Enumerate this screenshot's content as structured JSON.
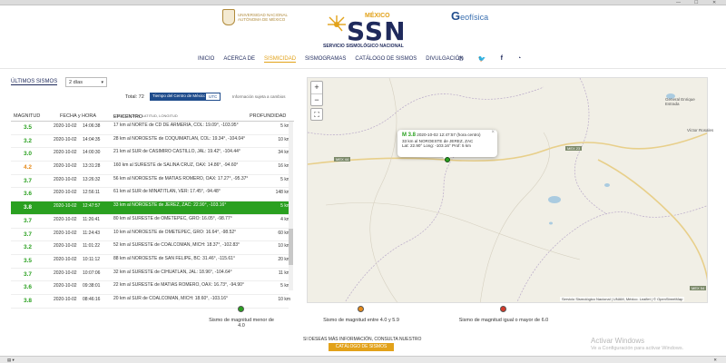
{
  "colors": {
    "navy": "#1f2a5c",
    "gold": "#e2a21a",
    "green": "#2aa020",
    "orange": "#e58a1a",
    "red": "#d43a2a"
  },
  "header": {
    "unam_text": "UNIVERSIDAD NACIONAL AUTÓNOMA DE MÉXICO",
    "ssn_mexico": "MÉXICO",
    "ssn_logo": "SSN",
    "ssn_subtitle": "SERVICIO SISMOLÓGICO NACIONAL",
    "geofisica": "eofísica"
  },
  "nav": {
    "items": [
      "INICIO",
      "ACERCA DE",
      "SISMICIDAD",
      "SISMOGRAMAS",
      "CATÁLOGO DE SISMOS",
      "DIVULGACIÓN"
    ],
    "icons": [
      "phone-icon",
      "twitter-icon",
      "facebook-icon",
      "rss-icon"
    ]
  },
  "panel": {
    "title": "ÚLTIMOS SISMOS",
    "days_selected": "2 días",
    "total_label": "Total: 72",
    "toggle_cm": "Tiempo del Centro de México",
    "toggle_utc": "UTC",
    "info_note": "Información sujeta a cambios"
  },
  "table": {
    "headers": {
      "magnitud": "MAGNITUD",
      "fecha": "FECHA y HORA",
      "epicentro": "EPICENTRO",
      "epicentro_sub": "LOCALIZACIÓN, LATITUD, LONGITUD",
      "profundidad": "PROFUNDIDAD"
    },
    "rows": [
      {
        "mag": "3.5",
        "color": "#2aa020",
        "date": "2020-10-02",
        "time": "14:06:38",
        "epi": "17 km al NORTE de CD DE ARMERIA, COL: 19.09°, -103.95°",
        "depth": "5 km"
      },
      {
        "mag": "3.2",
        "color": "#2aa020",
        "date": "2020-10-02",
        "time": "14:04:35",
        "epi": "28 km al NOROESTE de COQUIMATLAN, COL: 19.34°, -104.04°",
        "depth": "10 km"
      },
      {
        "mag": "3.0",
        "color": "#2aa020",
        "date": "2020-10-02",
        "time": "14:00:30",
        "epi": "21 km al SUR de CASIMIRO CASTILLO, JAL: 19.42°, -104.44°",
        "depth": "34 km"
      },
      {
        "mag": "4.2",
        "color": "#e58a1a",
        "date": "2020-10-02",
        "time": "13:31:28",
        "epi": "160 km al SURESTE de SALINA CRUZ, OAX: 14.86°, -94.60°",
        "depth": "16 km"
      },
      {
        "mag": "3.7",
        "color": "#2aa020",
        "date": "2020-10-02",
        "time": "13:26:32",
        "epi": "56 km al NOROESTE de MATIAS ROMERO, OAX: 17.27°, -95.37°",
        "depth": "5 km"
      },
      {
        "mag": "3.6",
        "color": "#2aa020",
        "date": "2020-10-02",
        "time": "12:56:11",
        "epi": "61 km al SUR de MINATITLAN, VER: 17.45°, -94.48°",
        "depth": "148 km"
      },
      {
        "mag": "3.8",
        "color": "#ffffff",
        "date": "2020-10-02",
        "time": "12:47:57",
        "epi": "33 km al NOROESTE de JEREZ, ZAC: 22.90°, -103.16°",
        "depth": "5 km",
        "selected": true
      },
      {
        "mag": "3.7",
        "color": "#2aa020",
        "date": "2020-10-02",
        "time": "11:26:41",
        "epi": "80 km al SURESTE de OMETEPEC, GRO: 16.05°, -98.77°",
        "depth": "4 km"
      },
      {
        "mag": "3.7",
        "color": "#2aa020",
        "date": "2020-10-02",
        "time": "11:24:43",
        "epi": "10 km al NOROESTE de OMETEPEC, GRO: 16.64°, -98.52°",
        "depth": "60 km"
      },
      {
        "mag": "3.2",
        "color": "#2aa020",
        "date": "2020-10-02",
        "time": "11:01:22",
        "epi": "52 km al SURESTE de COALCOMAN, MICH: 18.37°, -102.83°",
        "depth": "10 km"
      },
      {
        "mag": "3.5",
        "color": "#2aa020",
        "date": "2020-10-02",
        "time": "10:11:12",
        "epi": "88 km al NOROESTE de SAN FELIPE, BC: 31.46°, -115.61°",
        "depth": "20 km"
      },
      {
        "mag": "3.7",
        "color": "#2aa020",
        "date": "2020-10-02",
        "time": "10:07:06",
        "epi": "32 km al SURESTE de CIHUATLAN, JAL: 18.96°, -104.64°",
        "depth": "11 km"
      },
      {
        "mag": "3.6",
        "color": "#2aa020",
        "date": "2020-10-02",
        "time": "09:38:01",
        "epi": "22 km al SURESTE de MATIAS ROMERO, OAX: 16.73°, -94.90°",
        "depth": "5 km"
      },
      {
        "mag": "3.8",
        "color": "#2aa020",
        "date": "2020-10-02",
        "time": "08:46:16",
        "epi": "20 km al SUR de COALCOMAN, MICH: 18.60°, -103.16°",
        "depth": "10 km"
      }
    ]
  },
  "map": {
    "popup_mag": "M 3.8",
    "popup_time": "2020-10-02 12:47:57 (hora centro)",
    "popup_loc": "33 km al NOROESTE de JEREZ, ZAC",
    "popup_coords": "Lat: 22.90° Long: -103.16° Prof: 5 km",
    "popup_close": "×",
    "zoom_in": "+",
    "zoom_out": "−",
    "fullscreen": "⛶",
    "roads": [
      "MEX 44",
      "MEX 23",
      "MEX 54"
    ],
    "towns": [
      "General Enrique Estrada",
      "Víctor Rosales"
    ],
    "attribution": "Servicio Sismológico Nacional | UNAM, México. Leaflet | © OpenStreetMap"
  },
  "legend": {
    "low": "Sismo de magnitud menor de 4.0",
    "mid": "Sismo de magnitud entre 4.0 y 5.9",
    "high": "Sismo de magnitud igual o mayor de 6.0"
  },
  "footer": {
    "more_info": "SI DESEAS MÁS INFORMACIÓN, CONSULTA NUESTRO",
    "catalog_button": "CATÁLOGO DE SISMOS"
  },
  "windows": {
    "activate_title": "Activar Windows",
    "activate_sub": "Ve a Configuración para activar Windows."
  }
}
